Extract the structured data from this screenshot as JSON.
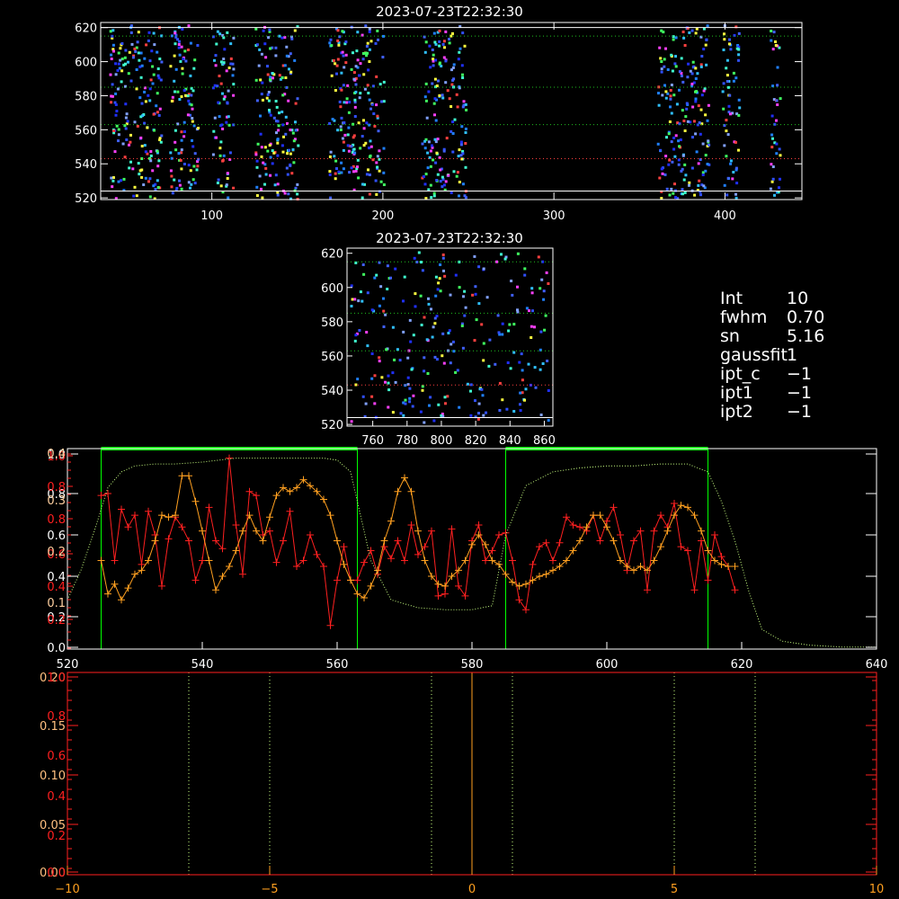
{
  "top_panel": {
    "title": "2023-07-23T22:32:30",
    "xticks": [
      "100",
      "200",
      "300",
      "400"
    ],
    "yticks": [
      "520",
      "540",
      "560",
      "580",
      "600",
      "620"
    ]
  },
  "mid_panel": {
    "title": "2023-07-23T22:32:30",
    "xticks": [
      "760",
      "780",
      "800",
      "820",
      "840",
      "860"
    ],
    "yticks": [
      "520",
      "540",
      "560",
      "580",
      "600",
      "620"
    ]
  },
  "info": {
    "rows": [
      {
        "key": "Int",
        "value": "10"
      },
      {
        "key": "fwhm",
        "value": "0.70"
      },
      {
        "key": "sn",
        "value": "5.16"
      },
      {
        "key": "gaussfit",
        "value": "1"
      },
      {
        "key": "ipt_c",
        "value": "−1"
      },
      {
        "key": "ipt1",
        "value": "−1"
      },
      {
        "key": "ipt2",
        "value": "−1"
      }
    ]
  },
  "colors": {
    "red": "#ff2020",
    "orange": "#ffa020",
    "green": "#00ff00",
    "ygreen": "#c8ff80"
  },
  "chart_data": [
    {
      "type": "heatmap",
      "title": "2023-07-23T22:32:30",
      "xlim": [
        35,
        445
      ],
      "ylim": [
        519,
        623
      ],
      "x_ticks": [
        100,
        200,
        300,
        400
      ],
      "y_ticks": [
        520,
        540,
        560,
        580,
        600,
        620
      ],
      "y_guides": [
        524,
        543,
        563,
        585,
        615
      ],
      "x_bands": [
        [
          40,
          70
        ],
        [
          75,
          92
        ],
        [
          100,
          112
        ],
        [
          125,
          150
        ],
        [
          168,
          200
        ],
        [
          222,
          248
        ],
        [
          360,
          390
        ],
        [
          398,
          408
        ],
        [
          426,
          432
        ]
      ]
    },
    {
      "type": "heatmap",
      "title": "2023-07-23T22:32:30",
      "xlim": [
        745,
        865
      ],
      "ylim": [
        519,
        623
      ],
      "x_ticks": [
        760,
        780,
        800,
        820,
        840,
        860
      ],
      "y_ticks": [
        520,
        540,
        560,
        580,
        600,
        620
      ],
      "y_guides": [
        524,
        543,
        563,
        585,
        615
      ]
    },
    {
      "type": "line",
      "xlim": [
        520,
        640
      ],
      "ylim": [
        0,
        1
      ],
      "x_ticks": [
        520,
        540,
        560,
        580,
        600,
        620,
        640
      ],
      "y_ticks_white": [
        "0.0",
        "0.2",
        "0.4",
        "0.6",
        "0.8",
        "1.0"
      ],
      "y_ticks_red": [
        "0.2",
        "0.4",
        "0.6",
        "0.8",
        "0.8",
        "1.0"
      ],
      "y_ticks_mixed": [
        "0.1",
        "0.2",
        "0.3",
        "0.4"
      ],
      "green_boxes": [
        [
          525,
          563
        ],
        [
          585,
          615
        ]
      ],
      "series": [
        {
          "color": "red",
          "x": [
            525,
            526,
            527,
            528,
            529,
            530,
            531,
            532,
            533,
            534,
            535,
            536,
            537,
            538,
            539,
            540,
            541,
            542,
            543,
            544,
            545,
            546,
            547,
            548,
            549,
            550,
            551,
            552,
            553,
            554,
            555,
            556,
            557,
            558,
            559,
            560,
            561,
            562,
            563,
            564,
            565,
            566,
            567,
            568,
            569,
            570,
            571,
            572,
            573,
            574,
            575,
            576,
            577,
            578,
            579,
            580,
            581,
            582,
            583,
            584,
            585,
            586,
            587,
            588,
            589,
            590,
            591,
            592,
            593,
            594,
            595,
            596,
            597,
            598,
            599,
            600,
            601,
            602,
            603,
            604,
            605,
            606,
            607,
            608,
            609,
            610,
            611,
            612,
            613,
            614,
            615,
            616,
            617,
            618,
            619
          ],
          "y": [
            0.78,
            0.79,
            0.45,
            0.71,
            0.62,
            0.68,
            0.43,
            0.7,
            0.58,
            0.32,
            0.56,
            0.67,
            0.62,
            0.55,
            0.35,
            0.45,
            0.72,
            0.55,
            0.51,
            0.97,
            0.63,
            0.38,
            0.8,
            0.78,
            0.58,
            0.6,
            0.44,
            0.55,
            0.7,
            0.42,
            0.45,
            0.58,
            0.48,
            0.42,
            0.12,
            0.35,
            0.52,
            0.35,
            0.35,
            0.44,
            0.5,
            0.38,
            0.52,
            0.46,
            0.55,
            0.45,
            0.63,
            0.48,
            0.52,
            0.6,
            0.27,
            0.28,
            0.61,
            0.32,
            0.27,
            0.55,
            0.63,
            0.45,
            0.5,
            0.58,
            0.59,
            0.45,
            0.25,
            0.2,
            0.43,
            0.52,
            0.54,
            0.45,
            0.54,
            0.67,
            0.63,
            0.62,
            0.6,
            0.68,
            0.55,
            0.65,
            0.72,
            0.58,
            0.4,
            0.55,
            0.6,
            0.3,
            0.6,
            0.68,
            0.62,
            0.74,
            0.52,
            0.5,
            0.3,
            0.55,
            0.35,
            0.58,
            0.47,
            0.42,
            0.3
          ]
        },
        {
          "color": "orange",
          "x": [
            525,
            526,
            527,
            528,
            529,
            530,
            531,
            532,
            533,
            534,
            535,
            536,
            537,
            538,
            539,
            540,
            541,
            542,
            543,
            544,
            545,
            546,
            547,
            548,
            549,
            550,
            551,
            552,
            553,
            554,
            555,
            556,
            557,
            558,
            559,
            560,
            561,
            562,
            563,
            564,
            565,
            566,
            567,
            568,
            569,
            570,
            571,
            572,
            573,
            574,
            575,
            576,
            577,
            578,
            579,
            580,
            581,
            582,
            583,
            584,
            585,
            586,
            587,
            588,
            589,
            590,
            591,
            592,
            593,
            594,
            595,
            596,
            597,
            598,
            599,
            600,
            601,
            602,
            603,
            604,
            605,
            606,
            607,
            608,
            609,
            610,
            611,
            612,
            613,
            614,
            615,
            616,
            617,
            618,
            619
          ],
          "y": [
            0.45,
            0.28,
            0.33,
            0.25,
            0.31,
            0.38,
            0.4,
            0.45,
            0.55,
            0.68,
            0.67,
            0.68,
            0.88,
            0.88,
            0.75,
            0.6,
            0.45,
            0.3,
            0.37,
            0.42,
            0.5,
            0.6,
            0.68,
            0.6,
            0.55,
            0.67,
            0.78,
            0.82,
            0.8,
            0.82,
            0.86,
            0.83,
            0.8,
            0.76,
            0.68,
            0.55,
            0.43,
            0.35,
            0.28,
            0.26,
            0.32,
            0.4,
            0.55,
            0.65,
            0.8,
            0.87,
            0.8,
            0.6,
            0.45,
            0.37,
            0.33,
            0.32,
            0.37,
            0.4,
            0.45,
            0.53,
            0.58,
            0.53,
            0.45,
            0.43,
            0.38,
            0.34,
            0.32,
            0.33,
            0.35,
            0.37,
            0.38,
            0.4,
            0.42,
            0.45,
            0.5,
            0.55,
            0.62,
            0.68,
            0.68,
            0.62,
            0.55,
            0.45,
            0.42,
            0.4,
            0.42,
            0.4,
            0.45,
            0.52,
            0.6,
            0.68,
            0.73,
            0.72,
            0.68,
            0.6,
            0.5,
            0.45,
            0.43,
            0.42,
            0.42
          ]
        },
        {
          "color": "ygreen",
          "dashed": true,
          "x": [
            520,
            522,
            524,
            526,
            528,
            530,
            533,
            536,
            540,
            545,
            550,
            555,
            558,
            560,
            562,
            563,
            565,
            568,
            572,
            576,
            580,
            583,
            585,
            588,
            592,
            596,
            600,
            604,
            608,
            612,
            615,
            617,
            619,
            621,
            623,
            626,
            630,
            635,
            640
          ],
          "y": [
            0.25,
            0.4,
            0.6,
            0.82,
            0.9,
            0.93,
            0.94,
            0.94,
            0.95,
            0.97,
            0.97,
            0.97,
            0.97,
            0.96,
            0.9,
            0.75,
            0.45,
            0.25,
            0.21,
            0.2,
            0.2,
            0.22,
            0.58,
            0.83,
            0.9,
            0.92,
            0.93,
            0.93,
            0.94,
            0.94,
            0.9,
            0.75,
            0.55,
            0.3,
            0.1,
            0.04,
            0.02,
            0.01,
            0.01
          ]
        }
      ]
    },
    {
      "type": "line",
      "xlim": [
        -10,
        10
      ],
      "ylim": [
        0,
        1
      ],
      "x_ticks": [
        -10,
        -5,
        0,
        5,
        10
      ],
      "y_ticks_white": [
        "0.00",
        "0.05",
        "0.10",
        "0.15",
        "0.20"
      ],
      "y_ticks_red": [
        "0.0",
        "0.2",
        "0.4",
        "0.6",
        "0.8",
        "1.0"
      ],
      "vlines_dotted": [
        -7,
        -5,
        -1,
        1,
        5,
        7
      ],
      "vline_solid": 0
    }
  ]
}
